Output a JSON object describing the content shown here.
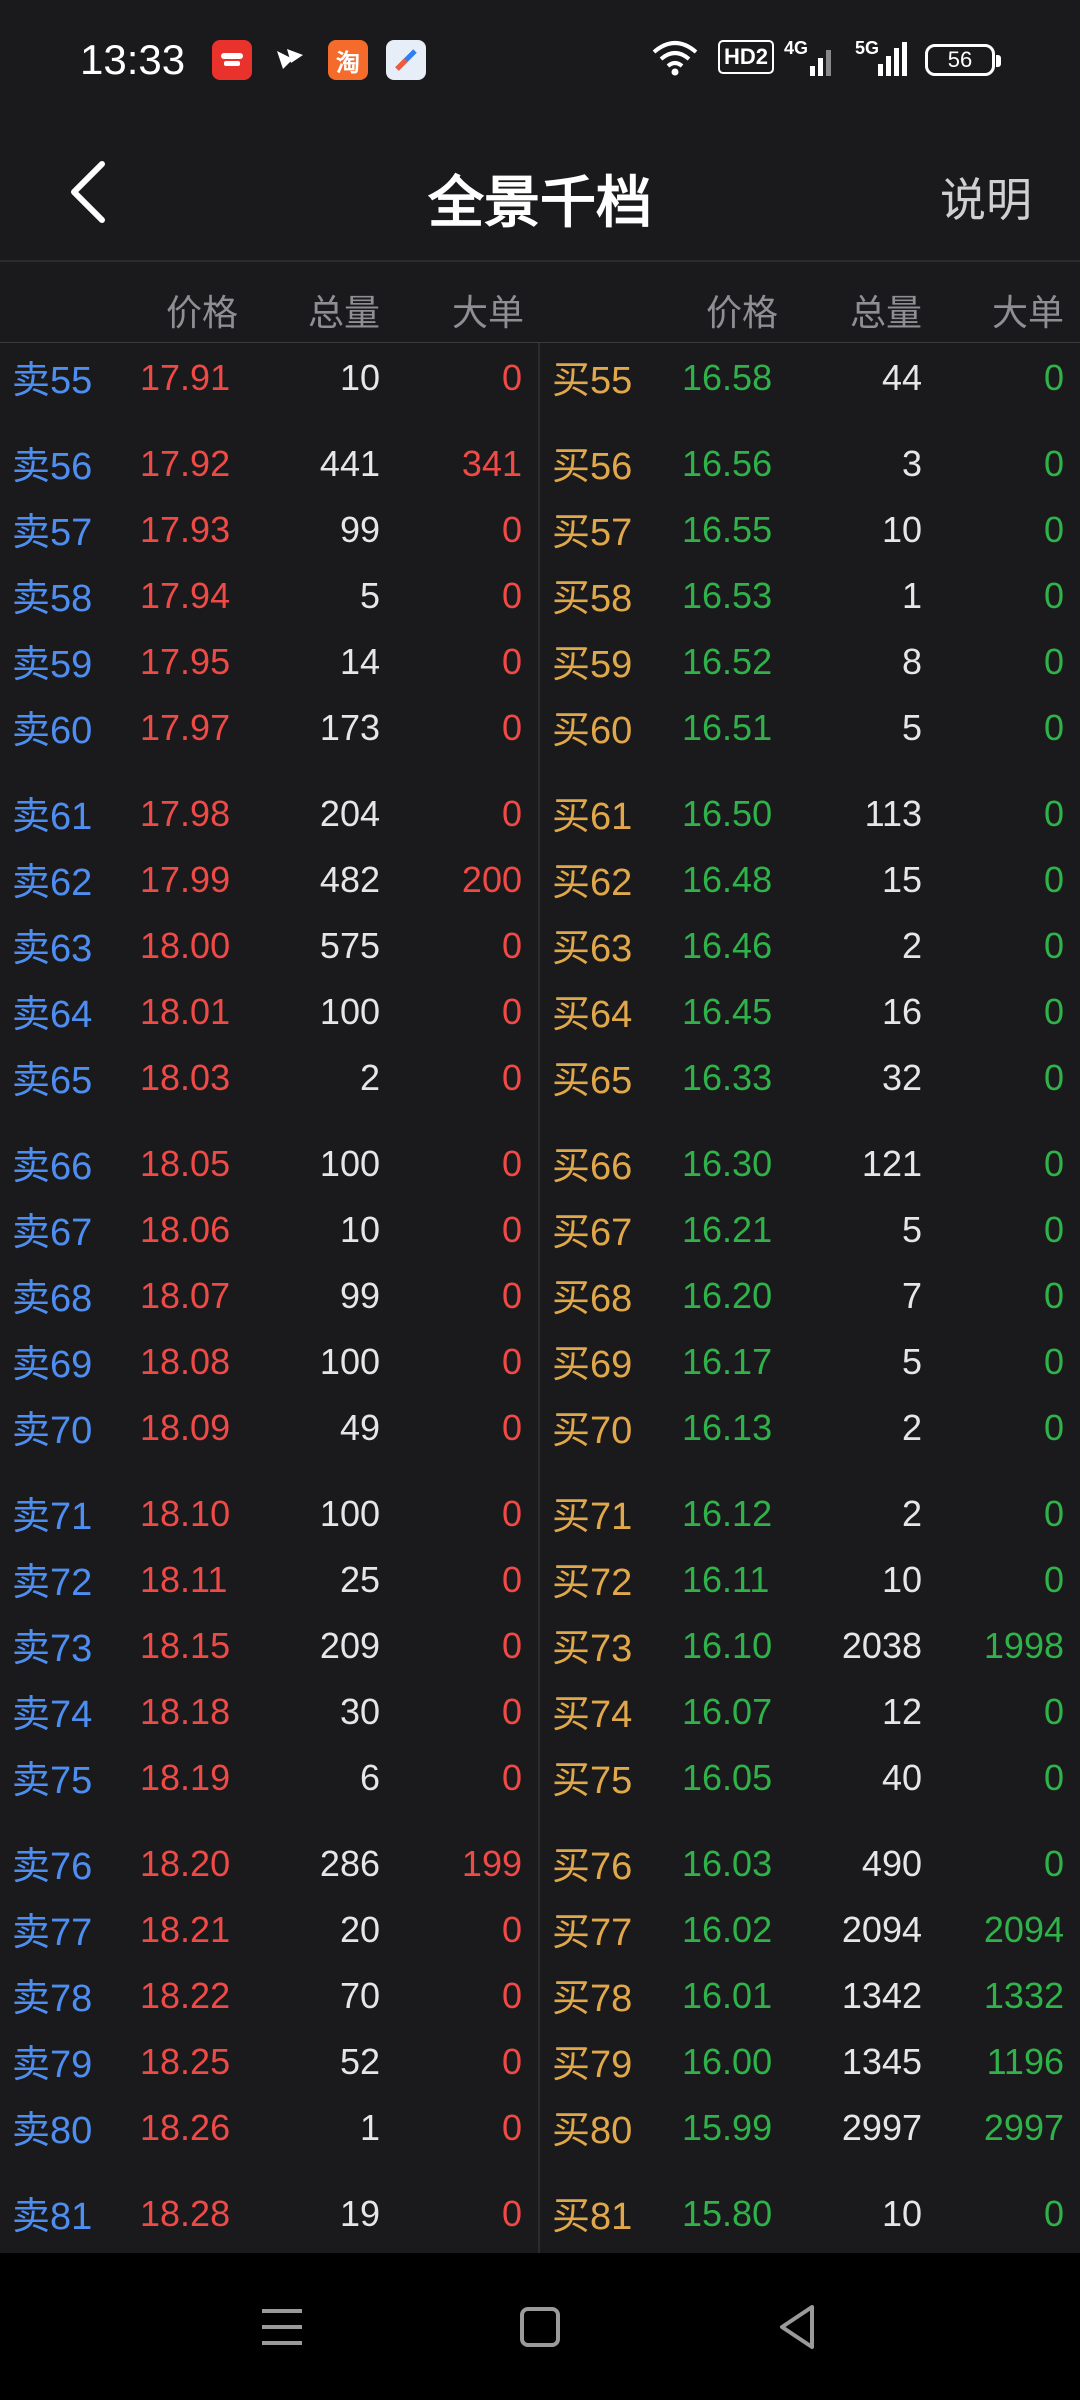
{
  "status_bar": {
    "time": "13:33",
    "apps": [
      "broker-app-icon",
      "feishu-icon",
      "taobao-icon",
      "browser-icon"
    ],
    "taobao_glyph": "淘",
    "hd_label": "HD2",
    "net1": "4G",
    "net2": "5G",
    "battery": "56"
  },
  "header": {
    "title": "全景千档",
    "help": "说明"
  },
  "columns": {
    "sell": {
      "price": "价格",
      "volume": "总量",
      "big": "大单"
    },
    "buy": {
      "price": "价格",
      "volume": "总量",
      "big": "大单"
    }
  },
  "rows": [
    {
      "sell_label": "卖55",
      "sell_price": "17.91",
      "sell_vol": "10",
      "sell_big": "0",
      "buy_label": "买55",
      "buy_price": "16.58",
      "buy_vol": "44",
      "buy_big": "0"
    },
    {
      "sell_label": "卖56",
      "sell_price": "17.92",
      "sell_vol": "441",
      "sell_big": "341",
      "buy_label": "买56",
      "buy_price": "16.56",
      "buy_vol": "3",
      "buy_big": "0"
    },
    {
      "sell_label": "卖57",
      "sell_price": "17.93",
      "sell_vol": "99",
      "sell_big": "0",
      "buy_label": "买57",
      "buy_price": "16.55",
      "buy_vol": "10",
      "buy_big": "0"
    },
    {
      "sell_label": "卖58",
      "sell_price": "17.94",
      "sell_vol": "5",
      "sell_big": "0",
      "buy_label": "买58",
      "buy_price": "16.53",
      "buy_vol": "1",
      "buy_big": "0"
    },
    {
      "sell_label": "卖59",
      "sell_price": "17.95",
      "sell_vol": "14",
      "sell_big": "0",
      "buy_label": "买59",
      "buy_price": "16.52",
      "buy_vol": "8",
      "buy_big": "0"
    },
    {
      "sell_label": "卖60",
      "sell_price": "17.97",
      "sell_vol": "173",
      "sell_big": "0",
      "buy_label": "买60",
      "buy_price": "16.51",
      "buy_vol": "5",
      "buy_big": "0"
    },
    {
      "sell_label": "卖61",
      "sell_price": "17.98",
      "sell_vol": "204",
      "sell_big": "0",
      "buy_label": "买61",
      "buy_price": "16.50",
      "buy_vol": "113",
      "buy_big": "0"
    },
    {
      "sell_label": "卖62",
      "sell_price": "17.99",
      "sell_vol": "482",
      "sell_big": "200",
      "buy_label": "买62",
      "buy_price": "16.48",
      "buy_vol": "15",
      "buy_big": "0"
    },
    {
      "sell_label": "卖63",
      "sell_price": "18.00",
      "sell_vol": "575",
      "sell_big": "0",
      "buy_label": "买63",
      "buy_price": "16.46",
      "buy_vol": "2",
      "buy_big": "0"
    },
    {
      "sell_label": "卖64",
      "sell_price": "18.01",
      "sell_vol": "100",
      "sell_big": "0",
      "buy_label": "买64",
      "buy_price": "16.45",
      "buy_vol": "16",
      "buy_big": "0"
    },
    {
      "sell_label": "卖65",
      "sell_price": "18.03",
      "sell_vol": "2",
      "sell_big": "0",
      "buy_label": "买65",
      "buy_price": "16.33",
      "buy_vol": "32",
      "buy_big": "0"
    },
    {
      "sell_label": "卖66",
      "sell_price": "18.05",
      "sell_vol": "100",
      "sell_big": "0",
      "buy_label": "买66",
      "buy_price": "16.30",
      "buy_vol": "121",
      "buy_big": "0"
    },
    {
      "sell_label": "卖67",
      "sell_price": "18.06",
      "sell_vol": "10",
      "sell_big": "0",
      "buy_label": "买67",
      "buy_price": "16.21",
      "buy_vol": "5",
      "buy_big": "0"
    },
    {
      "sell_label": "卖68",
      "sell_price": "18.07",
      "sell_vol": "99",
      "sell_big": "0",
      "buy_label": "买68",
      "buy_price": "16.20",
      "buy_vol": "7",
      "buy_big": "0"
    },
    {
      "sell_label": "卖69",
      "sell_price": "18.08",
      "sell_vol": "100",
      "sell_big": "0",
      "buy_label": "买69",
      "buy_price": "16.17",
      "buy_vol": "5",
      "buy_big": "0"
    },
    {
      "sell_label": "卖70",
      "sell_price": "18.09",
      "sell_vol": "49",
      "sell_big": "0",
      "buy_label": "买70",
      "buy_price": "16.13",
      "buy_vol": "2",
      "buy_big": "0"
    },
    {
      "sell_label": "卖71",
      "sell_price": "18.10",
      "sell_vol": "100",
      "sell_big": "0",
      "buy_label": "买71",
      "buy_price": "16.12",
      "buy_vol": "2",
      "buy_big": "0"
    },
    {
      "sell_label": "卖72",
      "sell_price": "18.11",
      "sell_vol": "25",
      "sell_big": "0",
      "buy_label": "买72",
      "buy_price": "16.11",
      "buy_vol": "10",
      "buy_big": "0"
    },
    {
      "sell_label": "卖73",
      "sell_price": "18.15",
      "sell_vol": "209",
      "sell_big": "0",
      "buy_label": "买73",
      "buy_price": "16.10",
      "buy_vol": "2038",
      "buy_big": "1998"
    },
    {
      "sell_label": "卖74",
      "sell_price": "18.18",
      "sell_vol": "30",
      "sell_big": "0",
      "buy_label": "买74",
      "buy_price": "16.07",
      "buy_vol": "12",
      "buy_big": "0"
    },
    {
      "sell_label": "卖75",
      "sell_price": "18.19",
      "sell_vol": "6",
      "sell_big": "0",
      "buy_label": "买75",
      "buy_price": "16.05",
      "buy_vol": "40",
      "buy_big": "0"
    },
    {
      "sell_label": "卖76",
      "sell_price": "18.20",
      "sell_vol": "286",
      "sell_big": "199",
      "buy_label": "买76",
      "buy_price": "16.03",
      "buy_vol": "490",
      "buy_big": "0"
    },
    {
      "sell_label": "卖77",
      "sell_price": "18.21",
      "sell_vol": "20",
      "sell_big": "0",
      "buy_label": "买77",
      "buy_price": "16.02",
      "buy_vol": "2094",
      "buy_big": "2094"
    },
    {
      "sell_label": "卖78",
      "sell_price": "18.22",
      "sell_vol": "70",
      "sell_big": "0",
      "buy_label": "买78",
      "buy_price": "16.01",
      "buy_vol": "1342",
      "buy_big": "1332"
    },
    {
      "sell_label": "卖79",
      "sell_price": "18.25",
      "sell_vol": "52",
      "sell_big": "0",
      "buy_label": "买79",
      "buy_price": "16.00",
      "buy_vol": "1345",
      "buy_big": "1196"
    },
    {
      "sell_label": "卖80",
      "sell_price": "18.26",
      "sell_vol": "1",
      "sell_big": "0",
      "buy_label": "买80",
      "buy_price": "15.99",
      "buy_vol": "2997",
      "buy_big": "2997"
    },
    {
      "sell_label": "卖81",
      "sell_price": "18.28",
      "sell_vol": "19",
      "sell_big": "0",
      "buy_label": "买81",
      "buy_price": "15.80",
      "buy_vol": "10",
      "buy_big": "0"
    }
  ],
  "colors": {
    "sell_label": "#4e8ef0",
    "buy_label": "#e0a84a",
    "sell_price": "#ef4a46",
    "buy_price": "#2fb24a",
    "background": "#1a1a1c"
  },
  "system_nav": [
    "menu-icon",
    "home-icon",
    "back-triangle-icon"
  ]
}
